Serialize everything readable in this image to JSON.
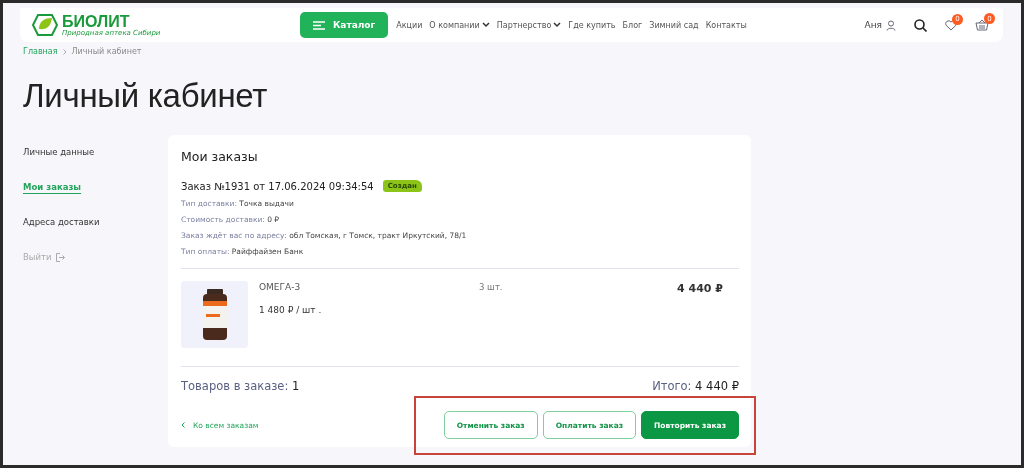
{
  "header": {
    "logo": {
      "name": "БИОЛИТ",
      "tagline": "Природная аптека Сибири"
    },
    "catalog_button": "Каталог",
    "nav": [
      {
        "label": "Акции",
        "dropdown": false
      },
      {
        "label": "О компании",
        "dropdown": true
      },
      {
        "label": "Партнерство",
        "dropdown": true
      },
      {
        "label": "Где купить",
        "dropdown": false
      },
      {
        "label": "Блог",
        "dropdown": false
      },
      {
        "label": "Зимний сад",
        "dropdown": false
      },
      {
        "label": "Контакты",
        "dropdown": false
      }
    ],
    "user": "Аня",
    "favorites_count": "0",
    "cart_count": "0"
  },
  "breadcrumbs": [
    "Главная",
    "Личный кабинет"
  ],
  "page_title": "Личный кабинет",
  "sidebar": {
    "items": [
      {
        "label": "Личные данные",
        "selected": false
      },
      {
        "label": "Мои заказы",
        "selected": true
      },
      {
        "label": "Адреса доставки",
        "selected": false
      }
    ],
    "logout": "Выйти"
  },
  "orders": {
    "title": "Мои заказы",
    "order": {
      "heading": "Заказ №1931 от 17.06.2024 09:34:54",
      "status": "Создан",
      "details": [
        {
          "label": "Тип доставки:",
          "value": "Точка выдачи"
        },
        {
          "label": "Стоимость доставки:",
          "value": "0 ₽"
        },
        {
          "label": "Заказ ждёт вас по адресу:",
          "value": "обл Томская, г Томск, тракт Иркутский, 78/1"
        },
        {
          "label": "Тип оплаты:",
          "value": "Райффайзен Банк"
        }
      ],
      "items": [
        {
          "name": "ОМЕГА-3",
          "unit_price": "1 480 ₽ / шт .",
          "quantity": "3 шт.",
          "total": "4 440 ₽"
        }
      ],
      "count_label": "Товаров в заказе:",
      "count": "1",
      "total_label": "Итого:",
      "total": "4 440 ₽"
    },
    "back_link": "Ко всем заказам",
    "buttons": [
      {
        "label": "Отменить заказ",
        "kind": "outline"
      },
      {
        "label": "Оплатить заказ",
        "kind": "outline"
      },
      {
        "label": "Повторить заказ",
        "kind": "primary"
      }
    ],
    "highlight": true
  }
}
